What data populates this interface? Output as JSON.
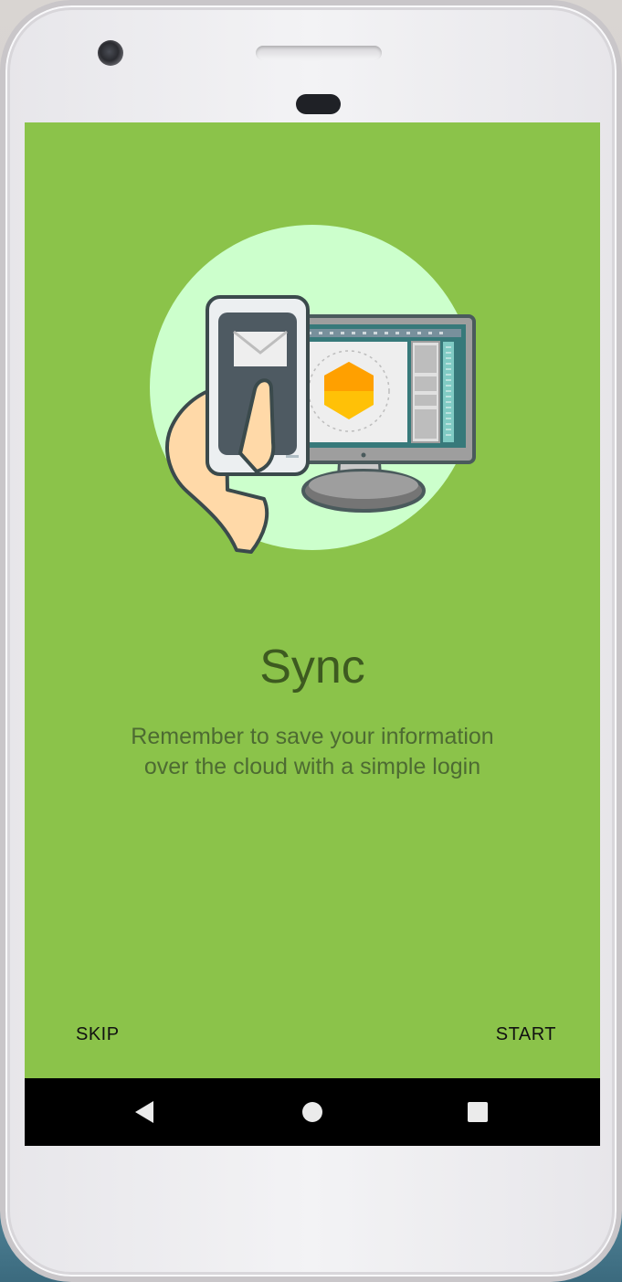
{
  "onboarding": {
    "title": "Sync",
    "description_line1": "Remember to save your information",
    "description_line2": "over the cloud with a simple login",
    "skip_label": "SKIP",
    "start_label": "START"
  },
  "illustration": {
    "name": "phone-to-desktop-sync-illustration",
    "circle_color": "#ccffcc",
    "accent_color": "#ffc107"
  },
  "navigation_bar": {
    "back_icon": "back-triangle-icon",
    "home_icon": "home-circle-icon",
    "recents_icon": "recents-square-icon"
  },
  "colors": {
    "screen_background": "#8bc34a",
    "title_color": "#3d5a20",
    "text_color": "#4d6b32",
    "nav_background": "#000000"
  }
}
